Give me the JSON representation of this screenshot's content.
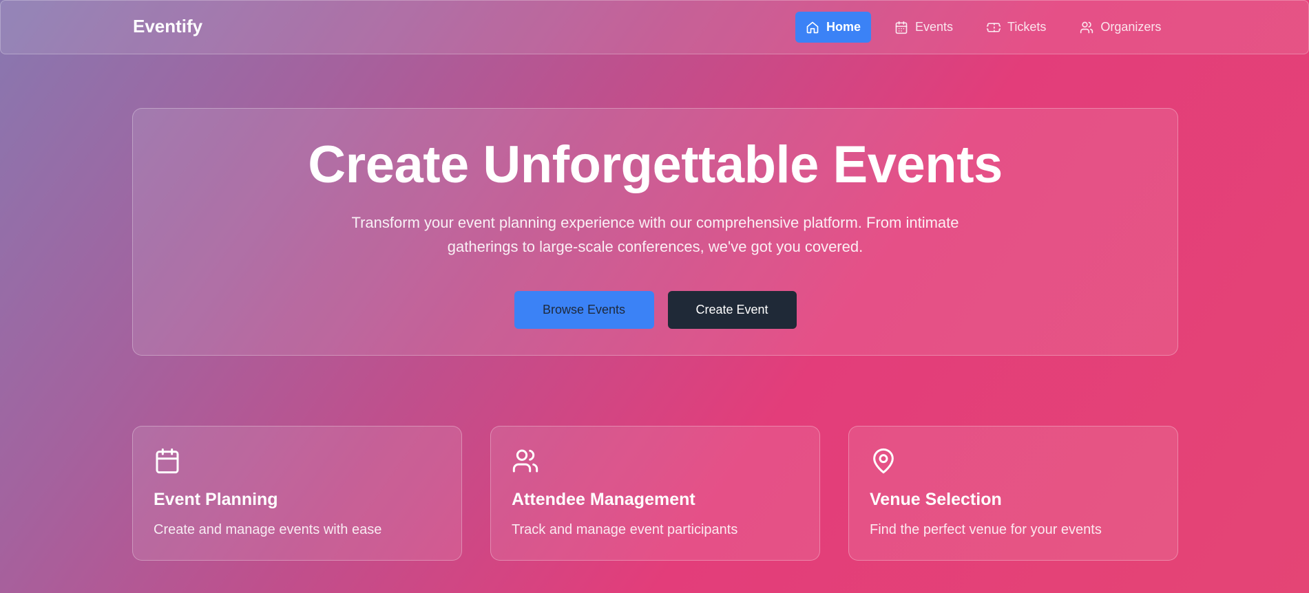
{
  "nav": {
    "brand": "Eventify",
    "items": [
      {
        "label": "Home",
        "icon": "home-icon",
        "active": true
      },
      {
        "label": "Events",
        "icon": "calendar-icon",
        "active": false
      },
      {
        "label": "Tickets",
        "icon": "ticket-icon",
        "active": false
      },
      {
        "label": "Organizers",
        "icon": "users-icon",
        "active": false
      }
    ]
  },
  "hero": {
    "title": "Create Unforgettable Events",
    "subtitle": "Transform your event planning experience with our comprehensive platform. From intimate gatherings to large-scale conferences, we've got you covered.",
    "primary_button": "Browse Events",
    "secondary_button": "Create Event"
  },
  "features": [
    {
      "icon": "calendar-icon",
      "title": "Event Planning",
      "description": "Create and manage events with ease"
    },
    {
      "icon": "users-icon",
      "title": "Attendee Management",
      "description": "Track and manage event participants"
    },
    {
      "icon": "map-pin-icon",
      "title": "Venue Selection",
      "description": "Find the perfect venue for your events"
    }
  ],
  "colors": {
    "accent": "#3b82f6",
    "dark_button": "#1f2937",
    "gradient_start": "#8878b0",
    "gradient_end": "#e33d7a"
  }
}
